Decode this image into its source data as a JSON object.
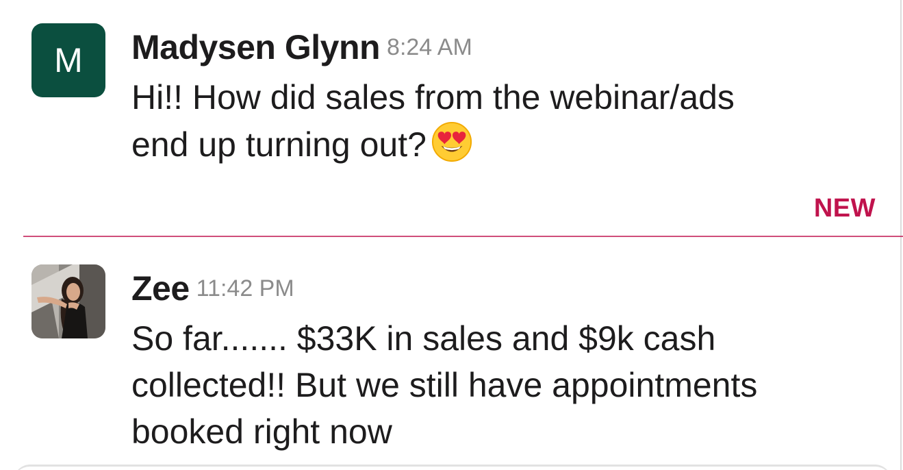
{
  "messages": [
    {
      "sender": "Madysen Glynn",
      "time": "8:24 AM",
      "avatar_letter": "M",
      "avatar_color": "#0b4f3f",
      "text_line_1": "Hi!! How did sales from the webinar/ads",
      "text_line_2": "end up turning out?",
      "emoji": "heart-eyes-face"
    },
    {
      "sender": "Zee",
      "time": "11:42 PM",
      "avatar": "profile-photo",
      "text_line_1": "So far....... $33K in sales and $9k cash",
      "text_line_2": "collected!! But we still have appointments",
      "text_line_3": "booked right now"
    }
  ],
  "new_divider": {
    "label": "NEW",
    "color": "#c0134d"
  }
}
